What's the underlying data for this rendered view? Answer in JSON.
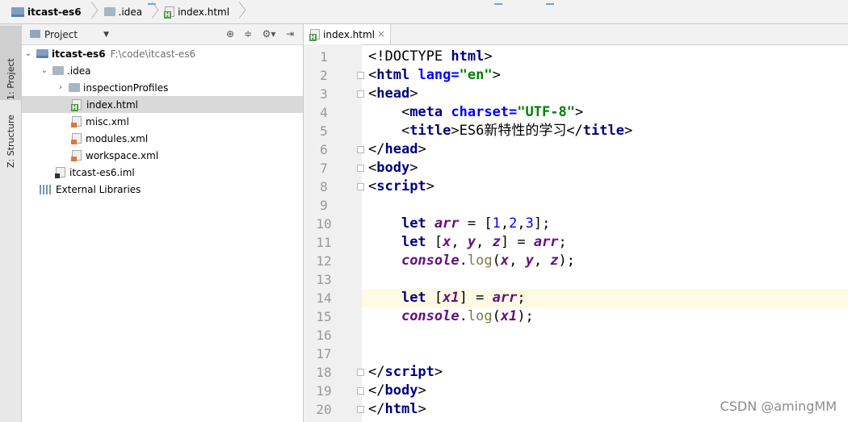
{
  "breadcrumb": {
    "items": [
      "itcast-es6",
      ".idea",
      "index.html"
    ]
  },
  "sidebar": {
    "tabs": [
      "1: Project",
      "Z: Structure"
    ]
  },
  "project_panel": {
    "title": "Project",
    "dropdown_icon": "chevron-down-icon",
    "tree": [
      {
        "label": "itcast-es6",
        "path": "F:\\code\\itcast-es6",
        "type": "project",
        "expanded": true
      },
      {
        "label": ".idea",
        "type": "folder",
        "expanded": true
      },
      {
        "label": "inspectionProfiles",
        "type": "folder",
        "expanded": false
      },
      {
        "label": "index.html",
        "type": "html",
        "selected": true
      },
      {
        "label": "misc.xml",
        "type": "xml"
      },
      {
        "label": "modules.xml",
        "type": "xml"
      },
      {
        "label": "workspace.xml",
        "type": "xml"
      },
      {
        "label": "itcast-es6.iml",
        "type": "iml"
      },
      {
        "label": "External Libraries",
        "type": "library"
      }
    ]
  },
  "editor": {
    "tab_label": "index.html",
    "current_line": 14,
    "lines": [
      {
        "num": "1",
        "code": [
          [
            "plain",
            "<!DOCTYPE "
          ],
          [
            "tg",
            "html"
          ],
          [
            "plain",
            ">"
          ]
        ]
      },
      {
        "num": "2",
        "code": [
          [
            "plain",
            "<"
          ],
          [
            "tg",
            "html"
          ],
          [
            "plain",
            " "
          ],
          [
            "an",
            "lang="
          ],
          [
            "av",
            "\"en\""
          ],
          [
            "plain",
            ">"
          ]
        ]
      },
      {
        "num": "3",
        "code": [
          [
            "plain",
            "<"
          ],
          [
            "tg",
            "head"
          ],
          [
            "plain",
            ">"
          ]
        ]
      },
      {
        "num": "4",
        "code": [
          [
            "plain",
            "    <"
          ],
          [
            "tg",
            "meta"
          ],
          [
            "plain",
            " "
          ],
          [
            "an",
            "charset="
          ],
          [
            "av",
            "\"UTF-8\""
          ],
          [
            "plain",
            ">"
          ]
        ]
      },
      {
        "num": "5",
        "code": [
          [
            "plain",
            "    <"
          ],
          [
            "tg",
            "title"
          ],
          [
            "plain",
            ">ES6新特性的学习</"
          ],
          [
            "tg",
            "title"
          ],
          [
            "plain",
            ">"
          ]
        ]
      },
      {
        "num": "6",
        "code": [
          [
            "plain",
            "</"
          ],
          [
            "tg",
            "head"
          ],
          [
            "plain",
            ">"
          ]
        ]
      },
      {
        "num": "7",
        "code": [
          [
            "plain",
            "<"
          ],
          [
            "tg",
            "body"
          ],
          [
            "plain",
            ">"
          ]
        ]
      },
      {
        "num": "8",
        "code": [
          [
            "plain",
            "<"
          ],
          [
            "tg",
            "script"
          ],
          [
            "plain",
            ">"
          ]
        ]
      },
      {
        "num": "9",
        "code": []
      },
      {
        "num": "10",
        "code": [
          [
            "plain",
            "    "
          ],
          [
            "kw",
            "let"
          ],
          [
            "plain",
            " "
          ],
          [
            "vr",
            "arr"
          ],
          [
            "plain",
            " = ["
          ],
          [
            "nm",
            "1"
          ],
          [
            "plain",
            ","
          ],
          [
            "nm",
            "2"
          ],
          [
            "plain",
            ","
          ],
          [
            "nm",
            "3"
          ],
          [
            "plain",
            "];"
          ]
        ]
      },
      {
        "num": "11",
        "code": [
          [
            "plain",
            "    "
          ],
          [
            "kw",
            "let"
          ],
          [
            "plain",
            " ["
          ],
          [
            "vr",
            "x"
          ],
          [
            "plain",
            ", "
          ],
          [
            "vr",
            "y"
          ],
          [
            "plain",
            ", "
          ],
          [
            "vr",
            "z"
          ],
          [
            "plain",
            "] = "
          ],
          [
            "vr",
            "arr"
          ],
          [
            "plain",
            ";"
          ]
        ]
      },
      {
        "num": "12",
        "code": [
          [
            "plain",
            "    "
          ],
          [
            "vr",
            "console"
          ],
          [
            "plain",
            "."
          ],
          [
            "fn",
            "log"
          ],
          [
            "plain",
            "("
          ],
          [
            "vr",
            "x"
          ],
          [
            "plain",
            ", "
          ],
          [
            "vr",
            "y"
          ],
          [
            "plain",
            ", "
          ],
          [
            "vr",
            "z"
          ],
          [
            "plain",
            ");"
          ]
        ]
      },
      {
        "num": "13",
        "code": []
      },
      {
        "num": "14",
        "code": [
          [
            "plain",
            "    "
          ],
          [
            "kw",
            "let"
          ],
          [
            "plain",
            " ["
          ],
          [
            "vr",
            "x1"
          ],
          [
            "plain",
            "] = "
          ],
          [
            "vr",
            "arr"
          ],
          [
            "plain",
            ";"
          ]
        ]
      },
      {
        "num": "15",
        "code": [
          [
            "plain",
            "    "
          ],
          [
            "vr",
            "console"
          ],
          [
            "plain",
            "."
          ],
          [
            "fn",
            "log"
          ],
          [
            "plain",
            "("
          ],
          [
            "vr",
            "x1"
          ],
          [
            "plain",
            ");"
          ]
        ]
      },
      {
        "num": "16",
        "code": []
      },
      {
        "num": "17",
        "code": []
      },
      {
        "num": "18",
        "code": [
          [
            "plain",
            "</"
          ],
          [
            "tg",
            "script"
          ],
          [
            "plain",
            ">"
          ]
        ]
      },
      {
        "num": "19",
        "code": [
          [
            "plain",
            "</"
          ],
          [
            "tg",
            "body"
          ],
          [
            "plain",
            ">"
          ]
        ]
      },
      {
        "num": "20",
        "code": [
          [
            "plain",
            "</"
          ],
          [
            "tg",
            "html"
          ],
          [
            "plain",
            ">"
          ]
        ]
      }
    ],
    "fold_lines": [
      2,
      3,
      6,
      7,
      8,
      18,
      19,
      20
    ]
  },
  "watermark": "CSDN @amingMM"
}
